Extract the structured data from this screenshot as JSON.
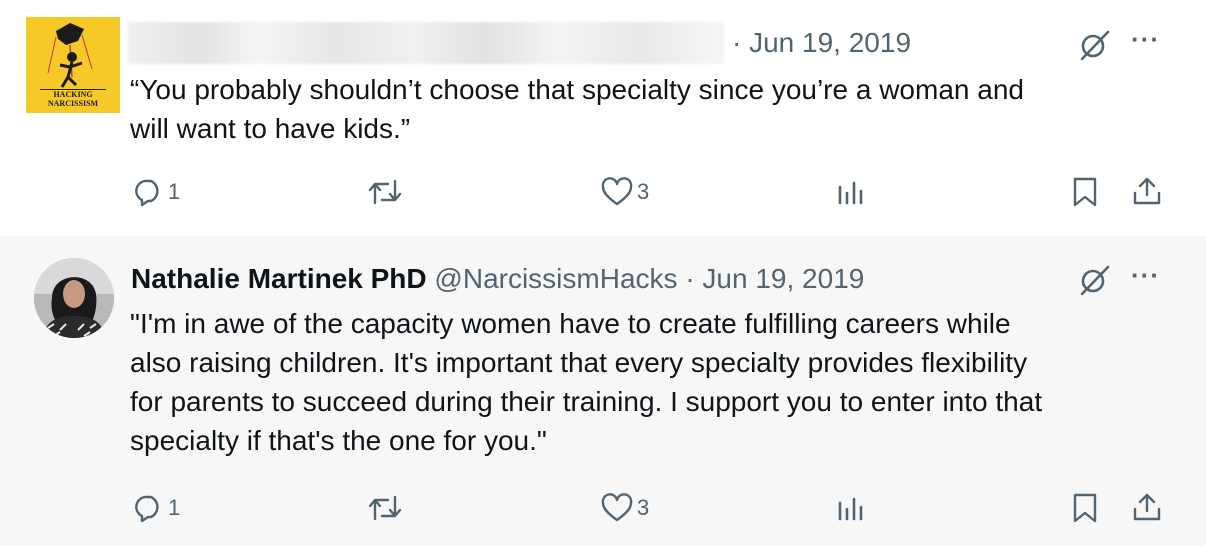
{
  "tweet1": {
    "date": "· Jun 19, 2019",
    "avatar_text": [
      "HACKING",
      "NARCISSISM"
    ],
    "text_lines": [
      "“You probably shouldn’t choose that specialty since you’re a woman and",
      "will want to have kids.”"
    ],
    "actions": {
      "replies": "1",
      "likes": "3"
    }
  },
  "tweet2": {
    "display_name": "Nathalie Martinek PhD",
    "handle": "@NarcissismHacks",
    "date": "· Jun 19, 2019",
    "text_lines": [
      "\"I'm in awe of the capacity women have to create fulfilling careers while",
      "also raising children. It's important that every specialty provides flexibility",
      "for parents to succeed during their training. I support you to enter into that",
      "specialty if that's the one for you.\""
    ],
    "actions": {
      "replies": "1",
      "likes": "3"
    }
  },
  "more_label": "···",
  "colors": {
    "text": "#0f1419",
    "muted": "#536471",
    "thread": "#cfd9de",
    "avatar_yellow": "#f6c828"
  }
}
